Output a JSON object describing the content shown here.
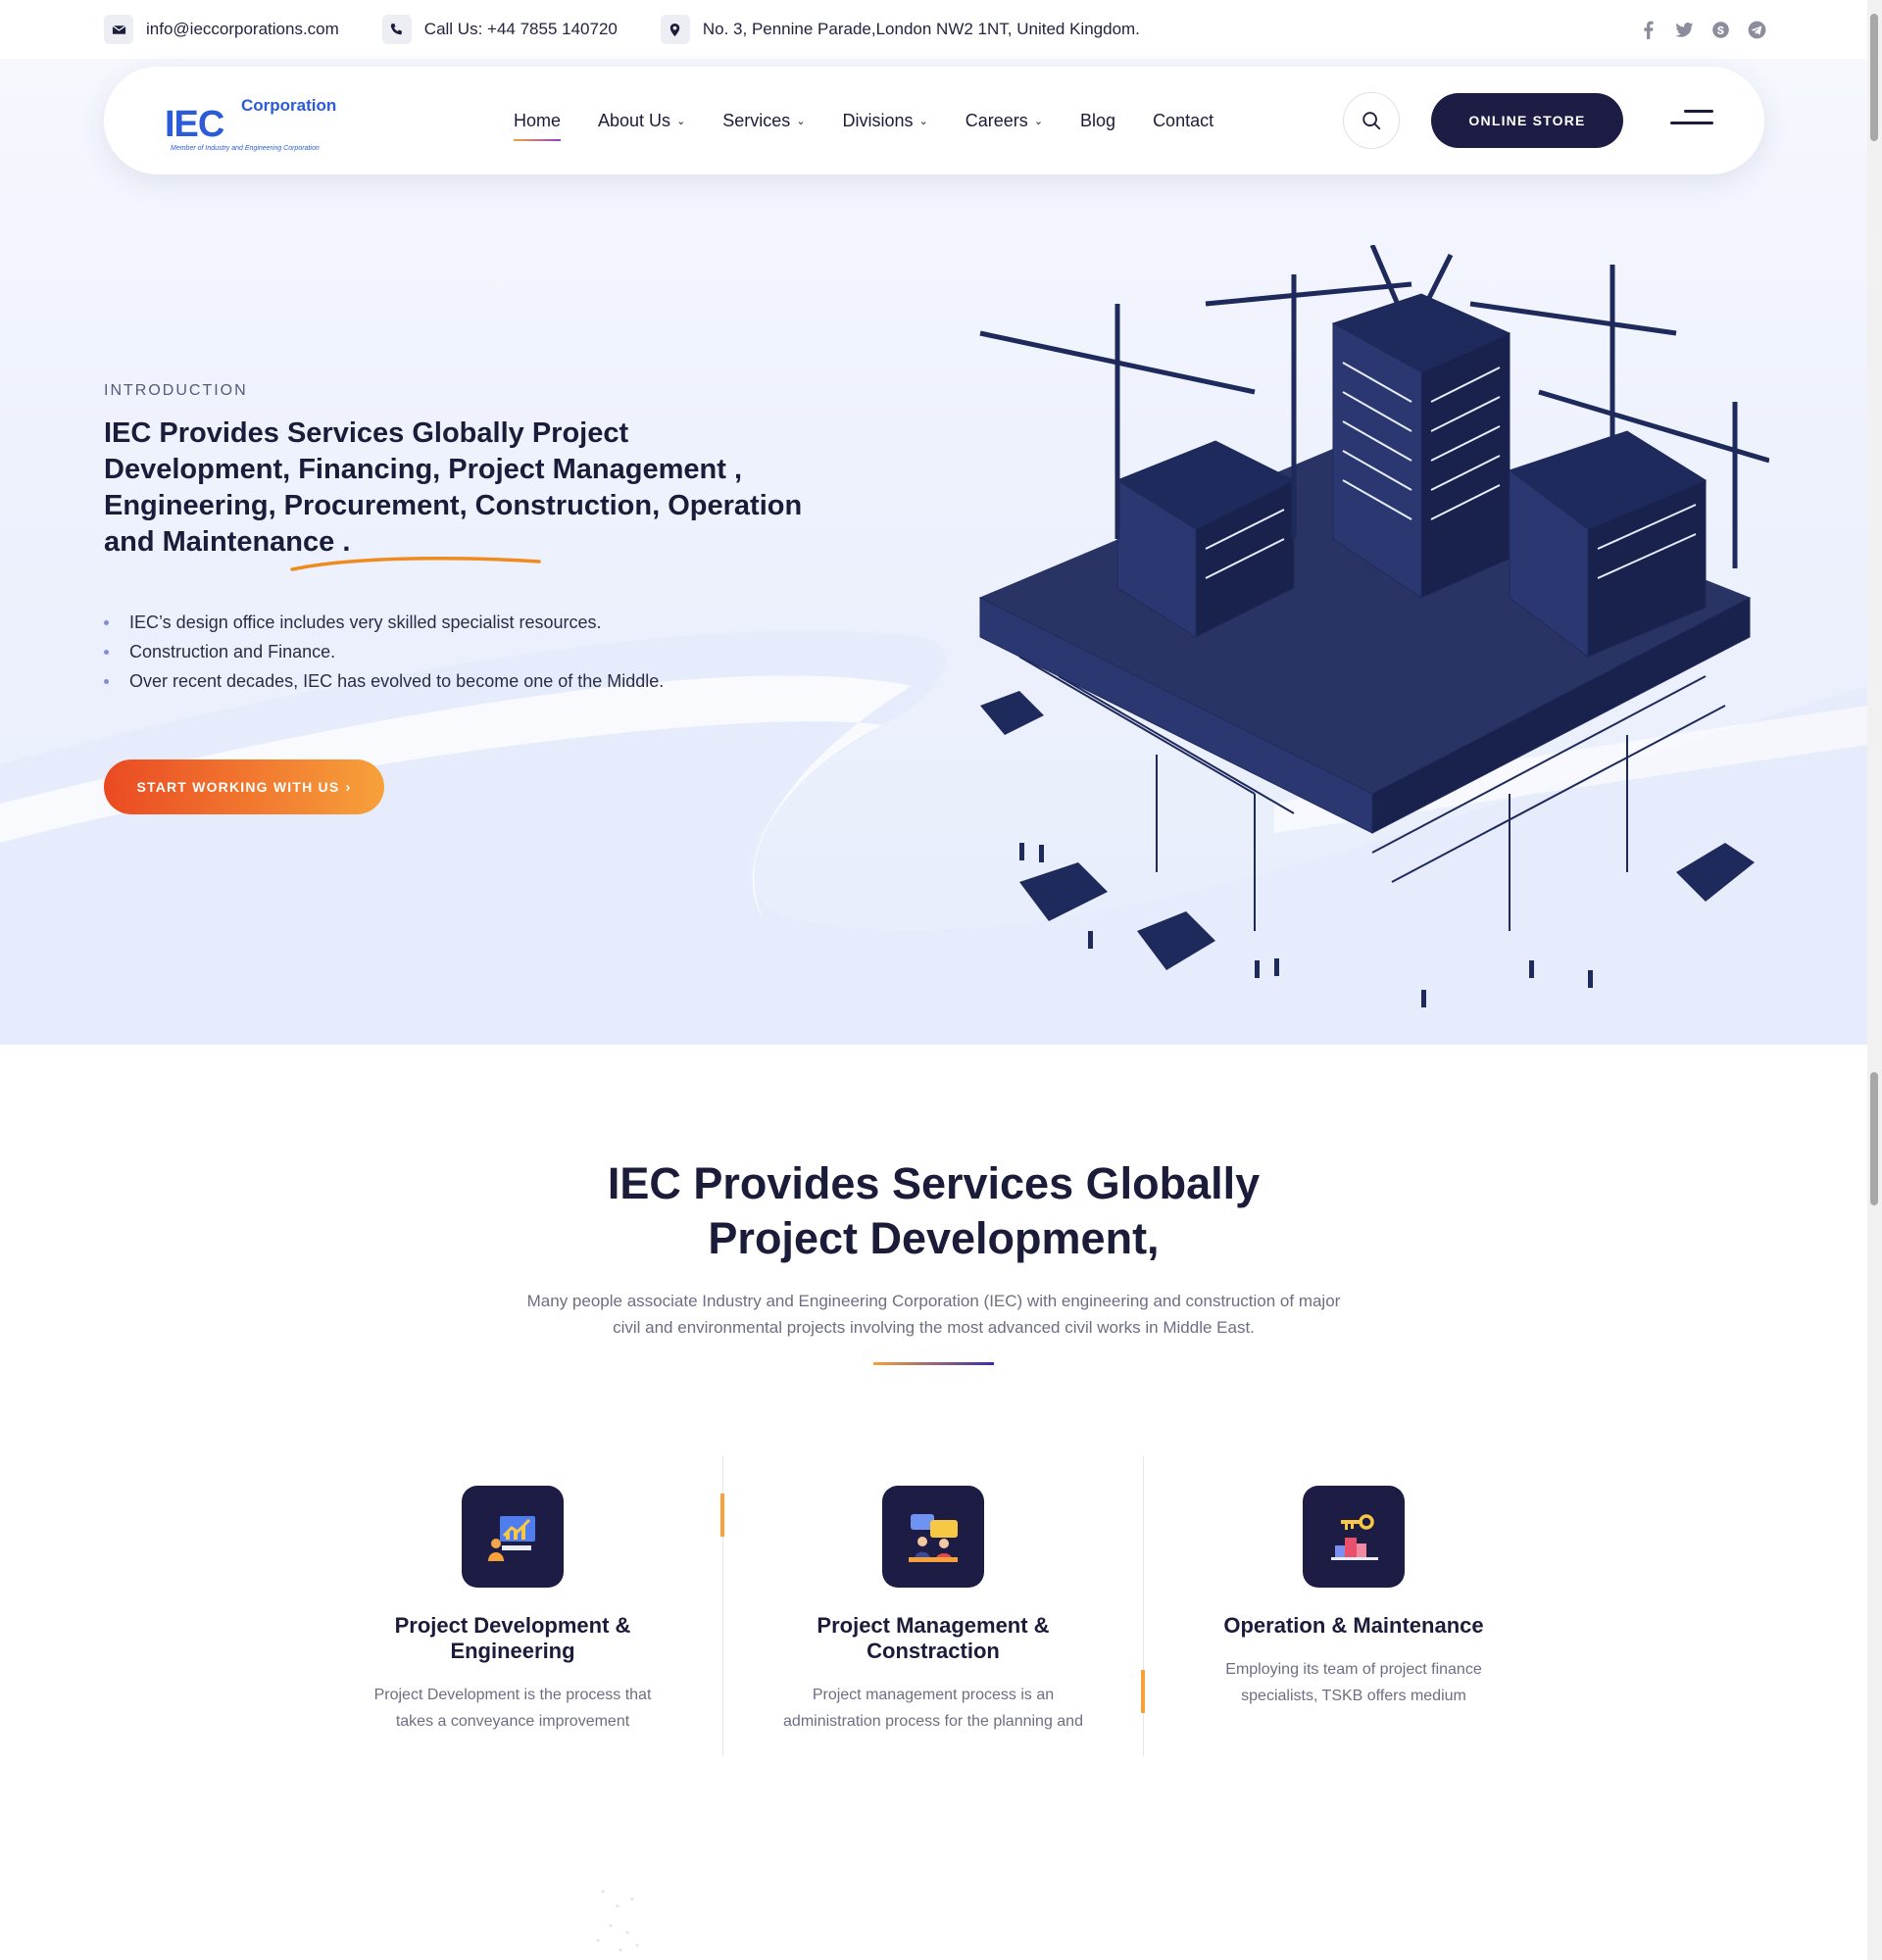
{
  "topbar": {
    "email": "info@ieccorporations.com",
    "phone": "Call Us: +44 7855 140720",
    "address": "No. 3, Pennine Parade,London NW2 1NT, United Kingdom."
  },
  "header": {
    "logo_main": "IEC",
    "logo_sub": "Corporation",
    "logo_tagline": "Member of Industry and Engineering Corporation",
    "nav": [
      {
        "label": "Home"
      },
      {
        "label": "About Us"
      },
      {
        "label": "Services"
      },
      {
        "label": "Divisions"
      },
      {
        "label": "Careers"
      },
      {
        "label": "Blog"
      },
      {
        "label": "Contact"
      }
    ],
    "store_label": "ONLINE STORE"
  },
  "hero": {
    "label": "INTRODUCTION",
    "title": "IEC Provides Services Globally Project Development, Financing, Project Management , Engineering, Procurement, Construction, Operation and Maintenance .",
    "bullets": [
      "IEC’s design office includes very skilled specialist resources.",
      "Construction and Finance.",
      "Over recent decades, IEC has evolved to become one of the Middle."
    ],
    "cta_label": "START WORKING WITH US"
  },
  "services": {
    "title_line1": "IEC Provides Services Globally",
    "title_line2": "Project Development,",
    "desc_line1": "Many people associate Industry and Engineering Corporation (IEC) with engineering and construction of major",
    "desc_line2": "civil and environmental projects involving the most advanced civil works in Middle East.",
    "cards": [
      {
        "title_line1": "Project Development &",
        "title_line2": "Engineering",
        "text_line1": "Project Development is the process that",
        "text_line2": "takes a conveyance improvement"
      },
      {
        "title_line1": "Project Management &",
        "title_line2": "Constraction",
        "text_line1": "Project management process is an",
        "text_line2": "administration process for the planning and"
      },
      {
        "title_line1": "Operation & Maintenance",
        "text_line1": "Employing its team of project finance",
        "text_line2": "specialists, TSKB offers medium"
      }
    ]
  },
  "colors": {
    "navy": "#1d1c45",
    "accent_orange": "#f7a13b",
    "cta_red": "#ea4a22",
    "brand_blue": "#2b5bd8"
  },
  "icons": [
    "envelope-icon",
    "phone-icon",
    "location-pin-icon",
    "facebook-icon",
    "twitter-icon",
    "skype-icon",
    "telegram-icon",
    "search-icon",
    "menu-icon",
    "chevron-down-icon",
    "chevron-right-icon"
  ]
}
